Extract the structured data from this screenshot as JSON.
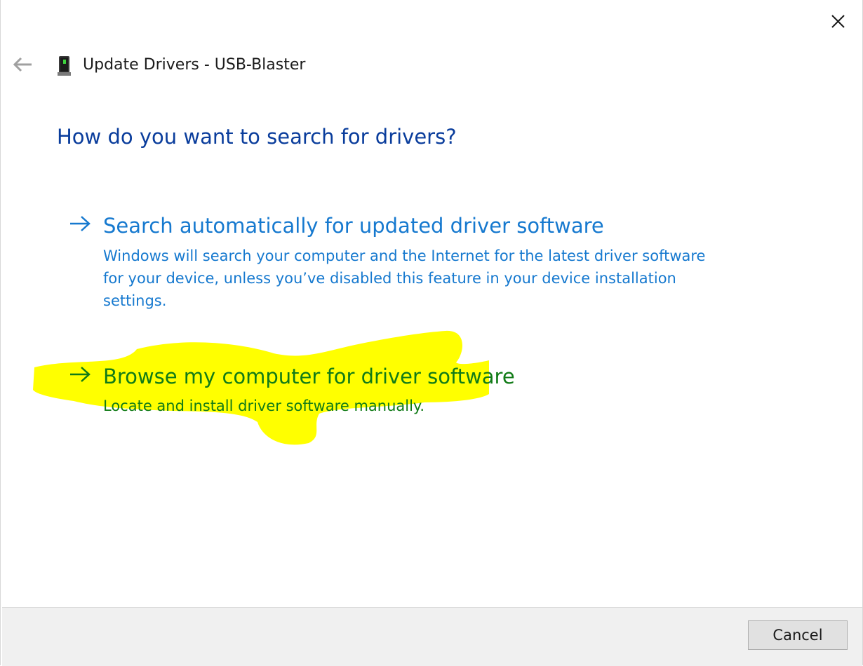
{
  "window": {
    "title": "Update Drivers - USB-Blaster",
    "close_icon": "close-icon",
    "back_icon": "back-arrow-icon",
    "device_icon": "usb-device-icon"
  },
  "main": {
    "heading": "How do you want to search for drivers?",
    "options": [
      {
        "icon": "arrow-right-icon",
        "title": "Search automatically for updated driver software",
        "description": "Windows will search your computer and the Internet for the latest driver software for your device, unless you’ve disabled this feature in your device installation settings.",
        "color": "#1679cf"
      },
      {
        "icon": "arrow-right-icon",
        "title": "Browse my computer for driver software",
        "description": "Locate and install driver software manually.",
        "color": "#117b17",
        "highlight_color": "#ffff00"
      }
    ]
  },
  "footer": {
    "cancel_label": "Cancel"
  },
  "colors": {
    "heading": "#0a3d9c",
    "footer_bg": "#f0f0f0"
  }
}
